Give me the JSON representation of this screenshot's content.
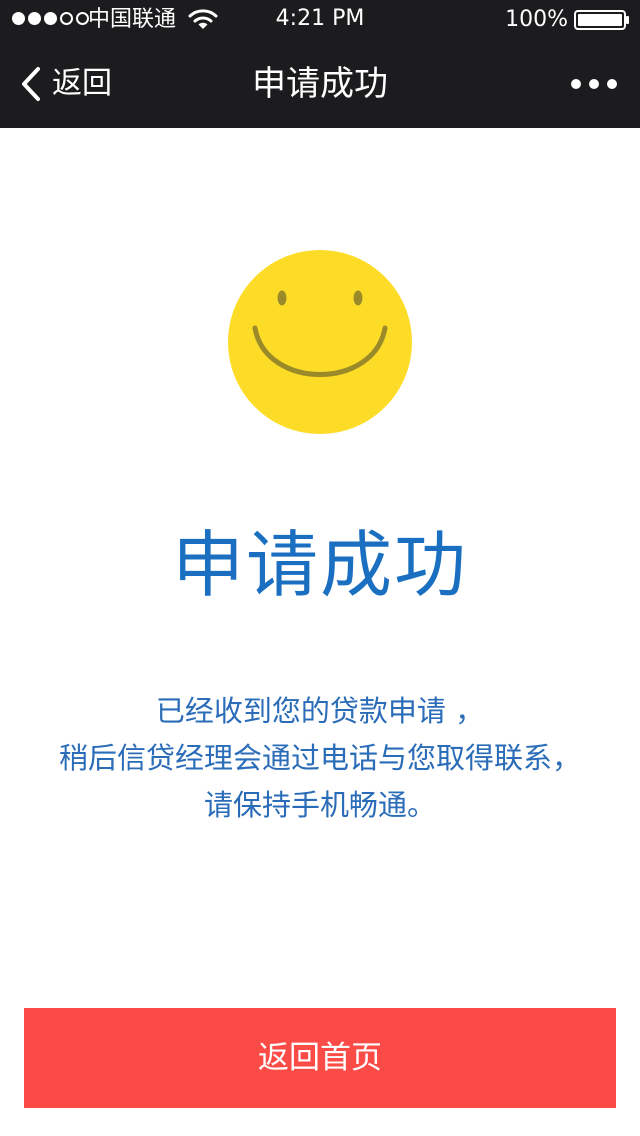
{
  "status_bar": {
    "carrier": "中国联通",
    "time": "4:21 PM",
    "battery": "100%",
    "signal_bars_filled": 3,
    "signal_bars_total": 5,
    "icons": [
      "signal-dots-icon",
      "wifi-icon",
      "battery-icon"
    ]
  },
  "nav": {
    "back_label": "返回",
    "title": "申请成功",
    "icons": [
      "chevron-left-icon",
      "more-dots-icon"
    ]
  },
  "content": {
    "illustration": "smiley-face-icon",
    "headline": "申请成功",
    "message_lines": [
      "已经收到您的贷款申请  ，",
      "稍后信贷经理会通过电话与您取得联系，",
      "请保持手机畅通。"
    ]
  },
  "button": {
    "label": "返回首页"
  },
  "colors": {
    "top_bar": "#1c1c1e",
    "headline": "#1a6fc1",
    "message": "#2a6cb8",
    "button": "#fb4b47",
    "smiley_face": "#fddc27",
    "smiley_features": "#9a8a2a"
  }
}
